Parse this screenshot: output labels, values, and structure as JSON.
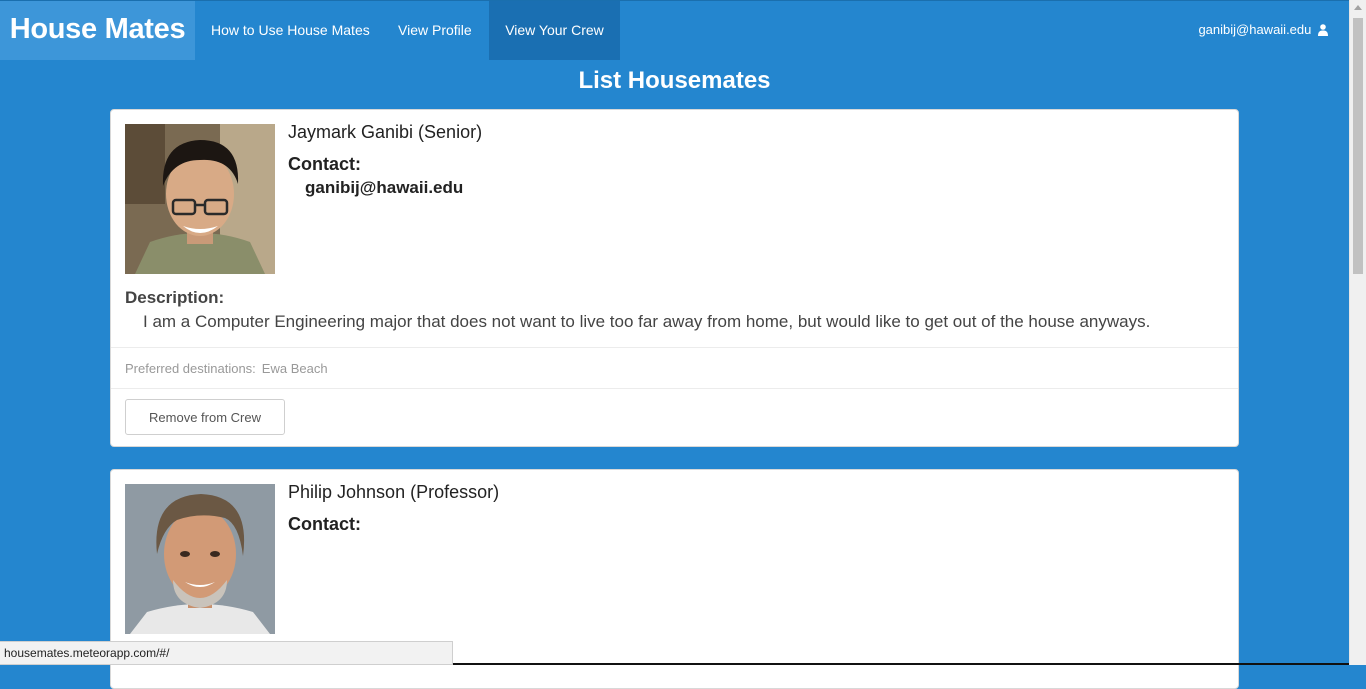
{
  "nav": {
    "brand": "House Mates",
    "links": [
      "How to Use House Mates",
      "View Profile",
      "View Your Crew"
    ],
    "user": "ganibij@hawaii.edu",
    "user_icon": "user-icon"
  },
  "page": {
    "title": "List Housemates"
  },
  "cards": [
    {
      "name": "Jaymark Ganibi (Senior)",
      "contact_label": "Contact:",
      "contact": "ganibij@hawaii.edu",
      "description_label": "Description:",
      "description": "I am a Computer Engineering major that does not want to live too far away from home, but would like to get out of the house anyways.",
      "preferred_label": "Preferred destinations:",
      "preferred": "Ewa Beach",
      "button": "Remove from Crew"
    },
    {
      "name": "Philip Johnson (Professor)",
      "contact_label": "Contact:"
    }
  ],
  "status_url": "housemates.meteorapp.com/#/",
  "colors": {
    "background": "#2486cf",
    "brand_bg": "#3d96d9",
    "active_tab": "#1a6fb2"
  }
}
